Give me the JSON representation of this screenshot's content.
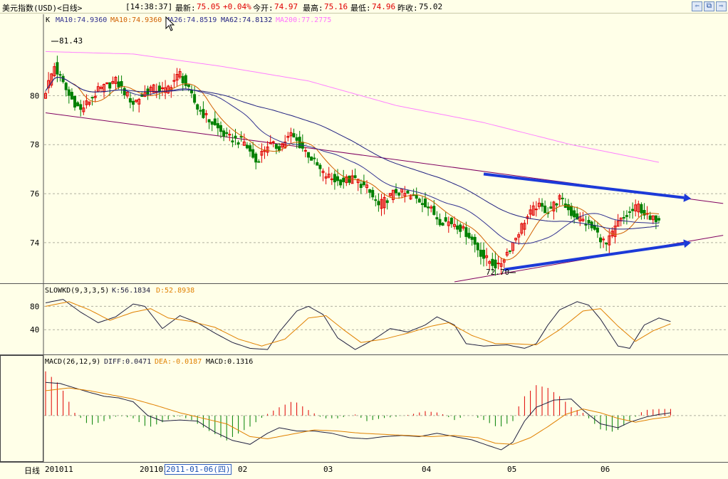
{
  "header": {
    "title": "美元指数(USD)<日线>",
    "time": "[14:38:37]",
    "latest_label": "最新:",
    "latest_value": "75.05",
    "change": "+0.04%",
    "open_label": "今开:",
    "open_value": "74.97",
    "high_label": "最高:",
    "high_value": "75.16",
    "low_label": "最低:",
    "low_value": "74.96",
    "prev_close_label": "昨收:",
    "prev_close_value": "75.02"
  },
  "colors": {
    "up": "#e00000",
    "down": "#008000",
    "ma10": "#d06000",
    "ma26": "#303090",
    "ma62": "#202080",
    "ma200": "#ff80ff",
    "arrow": "#1c3ad8",
    "trend": "#800060",
    "k": "#202040",
    "d": "#e08000"
  },
  "main_panel": {
    "legend": {
      "k": "K",
      "ma10a": "MA10:74.9360",
      "ma10b": "MA10:74.9360",
      "ma26": "MA26:74.8519",
      "ma62": "MA62:74.8132",
      "ma200": "MA200:77.2775"
    },
    "max_label": "81.43",
    "min_label": "72.70"
  },
  "kd_panel": {
    "legend": {
      "name": "SLOWKD(9,3,3,5)",
      "k": "K:56.1834",
      "d": "D:52.8938"
    }
  },
  "macd_panel": {
    "legend": {
      "name": "MACD(26,12,9)",
      "diff": "DIFF:0.0471",
      "dea": "DEA:-0.0187",
      "macd": "MACD:0.1316"
    }
  },
  "x_axis": {
    "period_label": "日线",
    "labels": [
      "201011",
      "201101",
      "02",
      "03",
      "04",
      "05",
      "06"
    ],
    "cursor_date": "2011-01-06(四)"
  },
  "chart_data": [
    {
      "type": "candlestick",
      "ylim": [
        72.4,
        82.8
      ],
      "yticks": [
        74,
        76,
        78,
        80
      ],
      "series": [
        "K",
        "MA10",
        "MA26",
        "MA62",
        "MA200"
      ],
      "close_anchors": [
        [
          0,
          80.2
        ],
        [
          3,
          81.2
        ],
        [
          8,
          80.0
        ],
        [
          12,
          79.4
        ],
        [
          18,
          80.2
        ],
        [
          24,
          80.6
        ],
        [
          30,
          79.7
        ],
        [
          36,
          80.3
        ],
        [
          41,
          80.2
        ],
        [
          46,
          80.9
        ],
        [
          52,
          79.5
        ],
        [
          56,
          79.0
        ],
        [
          62,
          78.3
        ],
        [
          68,
          78.1
        ],
        [
          72,
          77.3
        ],
        [
          76,
          78.0
        ],
        [
          80,
          77.9
        ],
        [
          84,
          78.4
        ],
        [
          90,
          77.6
        ],
        [
          95,
          76.8
        ],
        [
          100,
          76.5
        ],
        [
          106,
          76.6
        ],
        [
          110,
          76.2
        ],
        [
          114,
          75.5
        ],
        [
          120,
          76.1
        ],
        [
          125,
          75.9
        ],
        [
          130,
          75.6
        ],
        [
          135,
          74.9
        ],
        [
          140,
          74.8
        ],
        [
          145,
          74.3
        ],
        [
          150,
          73.4
        ],
        [
          155,
          73.0
        ],
        [
          160,
          74.0
        ],
        [
          164,
          74.9
        ],
        [
          168,
          75.5
        ],
        [
          172,
          75.3
        ],
        [
          176,
          75.8
        ],
        [
          180,
          75.2
        ],
        [
          184,
          74.9
        ],
        [
          188,
          74.5
        ],
        [
          192,
          73.9
        ],
        [
          196,
          74.8
        ],
        [
          200,
          75.2
        ],
        [
          203,
          75.5
        ],
        [
          207,
          74.9
        ],
        [
          210,
          75.05
        ]
      ],
      "ma200_anchors": [
        [
          0,
          81.8
        ],
        [
          30,
          81.7
        ],
        [
          60,
          81.2
        ],
        [
          90,
          80.6
        ],
        [
          120,
          79.6
        ],
        [
          150,
          78.9
        ],
        [
          180,
          78.0
        ],
        [
          210,
          77.28
        ]
      ],
      "trendlines": [
        {
          "from": [
            0,
            79.3
          ],
          "to": [
            232,
            75.6
          ]
        },
        {
          "from": [
            140,
            72.4
          ],
          "to": [
            232,
            74.3
          ]
        }
      ],
      "arrows": [
        {
          "from": [
            150,
            76.8
          ],
          "to": [
            221,
            75.8
          ]
        },
        {
          "from": [
            157,
            72.9
          ],
          "to": [
            221,
            74.0
          ]
        }
      ]
    },
    {
      "type": "line",
      "ylim": [
        0,
        100
      ],
      "yticks": [
        40,
        80
      ],
      "series": [
        {
          "name": "K",
          "anchors": [
            [
              0,
              86
            ],
            [
              6,
              92
            ],
            [
              12,
              70
            ],
            [
              18,
              52
            ],
            [
              24,
              62
            ],
            [
              30,
              84
            ],
            [
              34,
              80
            ],
            [
              40,
              42
            ],
            [
              46,
              64
            ],
            [
              52,
              52
            ],
            [
              58,
              34
            ],
            [
              64,
              18
            ],
            [
              70,
              8
            ],
            [
              76,
              6
            ],
            [
              80,
              36
            ],
            [
              86,
              72
            ],
            [
              90,
              80
            ],
            [
              95,
              66
            ],
            [
              100,
              26
            ],
            [
              106,
              6
            ],
            [
              112,
              22
            ],
            [
              118,
              42
            ],
            [
              124,
              36
            ],
            [
              130,
              48
            ],
            [
              134,
              62
            ],
            [
              140,
              48
            ],
            [
              144,
              16
            ],
            [
              150,
              12
            ],
            [
              158,
              14
            ],
            [
              164,
              8
            ],
            [
              168,
              16
            ],
            [
              172,
              48
            ],
            [
              176,
              74
            ],
            [
              182,
              88
            ],
            [
              186,
              82
            ],
            [
              190,
              58
            ],
            [
              196,
              12
            ],
            [
              200,
              8
            ],
            [
              205,
              48
            ],
            [
              210,
              60
            ],
            [
              214,
              54
            ]
          ]
        },
        {
          "name": "D",
          "anchors": [
            [
              0,
              80
            ],
            [
              8,
              88
            ],
            [
              15,
              74
            ],
            [
              22,
              56
            ],
            [
              30,
              70
            ],
            [
              36,
              76
            ],
            [
              42,
              60
            ],
            [
              50,
              54
            ],
            [
              58,
              44
            ],
            [
              66,
              24
            ],
            [
              74,
              12
            ],
            [
              82,
              24
            ],
            [
              90,
              60
            ],
            [
              96,
              64
            ],
            [
              102,
              40
            ],
            [
              108,
              18
            ],
            [
              116,
              24
            ],
            [
              124,
              34
            ],
            [
              132,
              46
            ],
            [
              138,
              52
            ],
            [
              146,
              30
            ],
            [
              154,
              16
            ],
            [
              160,
              16
            ],
            [
              168,
              14
            ],
            [
              176,
              40
            ],
            [
              184,
              72
            ],
            [
              190,
              76
            ],
            [
              196,
              46
            ],
            [
              202,
              20
            ],
            [
              208,
              38
            ],
            [
              214,
              50
            ]
          ]
        }
      ]
    },
    {
      "type": "bar+line",
      "ylim": [
        -0.8,
        0.9
      ],
      "yticks": [
        0
      ],
      "series": [
        {
          "name": "MACD",
          "anchors": [
            [
              0,
              0.8
            ],
            [
              5,
              0.55
            ],
            [
              10,
              0.05
            ],
            [
              15,
              -0.18
            ],
            [
              20,
              -0.1
            ],
            [
              25,
              0.0
            ],
            [
              30,
              -0.05
            ],
            [
              35,
              -0.22
            ],
            [
              40,
              -0.12
            ],
            [
              45,
              0.0
            ],
            [
              50,
              -0.08
            ],
            [
              55,
              -0.25
            ],
            [
              62,
              -0.45
            ],
            [
              70,
              -0.2
            ],
            [
              75,
              0.0
            ],
            [
              80,
              0.15
            ],
            [
              85,
              0.27
            ],
            [
              90,
              0.1
            ],
            [
              95,
              -0.05
            ],
            [
              100,
              -0.05
            ],
            [
              106,
              0.02
            ],
            [
              110,
              -0.1
            ],
            [
              115,
              -0.05
            ],
            [
              120,
              -0.02
            ],
            [
              125,
              0.02
            ],
            [
              130,
              0.08
            ],
            [
              135,
              0.05
            ],
            [
              140,
              -0.08
            ],
            [
              145,
              0.02
            ],
            [
              150,
              -0.08
            ],
            [
              155,
              -0.22
            ],
            [
              160,
              -0.1
            ],
            [
              163,
              0.3
            ],
            [
              168,
              0.55
            ],
            [
              172,
              0.5
            ],
            [
              176,
              0.35
            ],
            [
              180,
              0.15
            ],
            [
              184,
              0.05
            ],
            [
              190,
              -0.25
            ],
            [
              195,
              -0.3
            ],
            [
              200,
              -0.1
            ],
            [
              205,
              0.1
            ],
            [
              210,
              0.12
            ],
            [
              214,
              0.12
            ]
          ]
        },
        {
          "name": "DIFF",
          "anchors": [
            [
              0,
              0.6
            ],
            [
              5,
              0.58
            ],
            [
              10,
              0.5
            ],
            [
              15,
              0.42
            ],
            [
              20,
              0.35
            ],
            [
              25,
              0.32
            ],
            [
              30,
              0.25
            ],
            [
              35,
              0.0
            ],
            [
              40,
              -0.1
            ],
            [
              46,
              -0.08
            ],
            [
              52,
              -0.1
            ],
            [
              58,
              -0.3
            ],
            [
              64,
              -0.45
            ],
            [
              70,
              -0.52
            ],
            [
              76,
              -0.32
            ],
            [
              80,
              -0.22
            ],
            [
              86,
              -0.28
            ],
            [
              92,
              -0.28
            ],
            [
              98,
              -0.32
            ],
            [
              104,
              -0.4
            ],
            [
              110,
              -0.42
            ],
            [
              116,
              -0.38
            ],
            [
              122,
              -0.36
            ],
            [
              128,
              -0.38
            ],
            [
              134,
              -0.32
            ],
            [
              140,
              -0.38
            ],
            [
              146,
              -0.44
            ],
            [
              152,
              -0.55
            ],
            [
              156,
              -0.62
            ],
            [
              160,
              -0.48
            ],
            [
              164,
              -0.1
            ],
            [
              168,
              0.15
            ],
            [
              174,
              0.28
            ],
            [
              180,
              0.3
            ],
            [
              184,
              0.1
            ],
            [
              190,
              -0.15
            ],
            [
              196,
              -0.22
            ],
            [
              200,
              -0.12
            ],
            [
              206,
              -0.02
            ],
            [
              210,
              0.02
            ],
            [
              214,
              0.05
            ]
          ]
        },
        {
          "name": "DEA",
          "anchors": [
            [
              0,
              0.45
            ],
            [
              8,
              0.5
            ],
            [
              15,
              0.45
            ],
            [
              22,
              0.38
            ],
            [
              30,
              0.3
            ],
            [
              38,
              0.18
            ],
            [
              46,
              0.05
            ],
            [
              54,
              -0.05
            ],
            [
              62,
              -0.15
            ],
            [
              70,
              -0.38
            ],
            [
              76,
              -0.42
            ],
            [
              84,
              -0.34
            ],
            [
              92,
              -0.26
            ],
            [
              100,
              -0.28
            ],
            [
              108,
              -0.32
            ],
            [
              116,
              -0.34
            ],
            [
              124,
              -0.36
            ],
            [
              132,
              -0.38
            ],
            [
              140,
              -0.36
            ],
            [
              148,
              -0.4
            ],
            [
              154,
              -0.5
            ],
            [
              160,
              -0.52
            ],
            [
              166,
              -0.4
            ],
            [
              172,
              -0.2
            ],
            [
              178,
              0.02
            ],
            [
              184,
              0.12
            ],
            [
              190,
              0.05
            ],
            [
              196,
              -0.05
            ],
            [
              202,
              -0.12
            ],
            [
              208,
              -0.06
            ],
            [
              214,
              -0.02
            ]
          ]
        }
      ]
    }
  ]
}
